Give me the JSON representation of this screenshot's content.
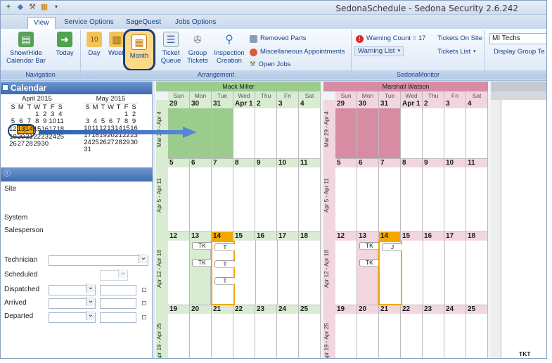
{
  "window": {
    "title": "SedonaSchedule - Sedona Security 2.6.242"
  },
  "qat_icons": [
    "add-icon",
    "tag-icon",
    "tools-icon",
    "grid-icon",
    "dropdown-icon"
  ],
  "tabs": [
    "View",
    "Service Options",
    "SageQuest",
    "Jobs Options"
  ],
  "ribbon": {
    "navigation": {
      "label": "Navigation",
      "show_hide": "Show/Hide\nCalendar Bar",
      "today": "Today"
    },
    "arrangement": {
      "label": "Arrangement",
      "day": "Day",
      "week": "Week",
      "month": "Month",
      "ticket_queue": "Ticket\nQueue",
      "group_tickets": "Group\nTickets",
      "inspection": "Inspection\nCreation",
      "removed_parts": "Removed Parts",
      "misc_appts": "Miscellaneous Appointments",
      "open_jobs": "Open Jobs"
    },
    "monitor": {
      "label": "SedonaMonitor",
      "warning_count": "Warning Count = 17",
      "warning_list": "Warning List",
      "tickets_on_site": "Tickets On Site",
      "tickets_list": "Tickets List"
    },
    "techs": {
      "value": "MI Techs",
      "display_group": "Display Group Te"
    }
  },
  "calendar": {
    "header": "Calendar",
    "april": {
      "title": "April 2015",
      "dow": [
        "S",
        "M",
        "T",
        "W",
        "T",
        "F",
        "S"
      ],
      "rows": [
        [
          "",
          "",
          "",
          "1",
          "2",
          "3",
          "4"
        ],
        [
          "5",
          "6",
          "7",
          "8",
          "9",
          "10",
          "11"
        ],
        [
          "12",
          "13",
          "14",
          "15",
          "16",
          "17",
          "18"
        ],
        [
          "19",
          "20",
          "21",
          "22",
          "23",
          "24",
          "25"
        ],
        [
          "26",
          "27",
          "28",
          "29",
          "30",
          "",
          ""
        ]
      ]
    },
    "may": {
      "title": "May 2015",
      "dow": [
        "S",
        "M",
        "T",
        "W",
        "T",
        "F",
        "S"
      ],
      "rows": [
        [
          "",
          "",
          "",
          "",
          "",
          "1",
          "2"
        ],
        [
          "3",
          "4",
          "5",
          "6",
          "7",
          "8",
          "9"
        ],
        [
          "10",
          "11",
          "12",
          "13",
          "14",
          "15",
          "16"
        ],
        [
          "17",
          "18",
          "19",
          "20",
          "21",
          "22",
          "23"
        ],
        [
          "24",
          "25",
          "26",
          "27",
          "28",
          "29",
          "30"
        ],
        [
          "31",
          "",
          "",
          "",
          "",
          "",
          ""
        ]
      ]
    }
  },
  "info": {
    "header_icon": "info-icon",
    "fields": [
      "Site",
      "System",
      "Salesperson",
      "Technician",
      "Scheduled",
      "Dispatched",
      "Arrived",
      "Departed"
    ]
  },
  "schedule": {
    "dows": [
      "Sun",
      "Mon",
      "Tue",
      "Wed",
      "Thu",
      "Fri",
      "Sat"
    ],
    "people": [
      {
        "name": "Mack Miller",
        "color": "#9ccb8e"
      },
      {
        "name": "Marshall Watson",
        "color": "#d68da3"
      }
    ],
    "weeks": [
      {
        "label": "Mar 29 - Apr 4",
        "days": [
          "29",
          "30",
          "31",
          "Apr 1",
          "2",
          "3",
          "4"
        ]
      },
      {
        "label": "Apr 5 - Apr 11",
        "days": [
          "5",
          "6",
          "7",
          "8",
          "9",
          "10",
          "11"
        ]
      },
      {
        "label": "Apr 12 - Apr 18",
        "days": [
          "12",
          "13",
          "14",
          "15",
          "16",
          "17",
          "18"
        ]
      },
      {
        "label": "Apr 19 - Apr 25",
        "days": [
          "19",
          "20",
          "21",
          "22",
          "23",
          "24",
          "25"
        ]
      }
    ],
    "mack_chips": {
      "mon": [
        "TK",
        "TK"
      ],
      "tue": [
        "T",
        "T",
        "T"
      ]
    },
    "marshall_chips": {
      "mon": [
        "TK",
        "TK"
      ],
      "tue": [
        "J"
      ]
    },
    "third_partial": "TKT"
  }
}
